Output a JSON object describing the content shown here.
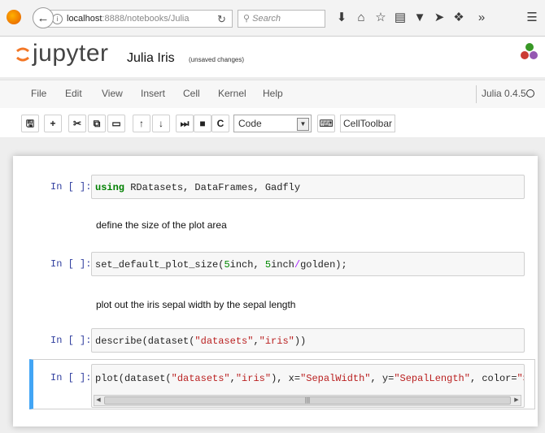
{
  "browser": {
    "url_host": "localhost",
    "url_rest": ":8888/notebooks/Julia",
    "search_placeholder": "Search"
  },
  "jupyter": {
    "logo_text": "jupyter",
    "notebook_name": "Julia Iris",
    "checkpoint_status": "(unsaved changes)"
  },
  "menu": {
    "items": [
      "File",
      "Edit",
      "View",
      "Insert",
      "Cell",
      "Kernel",
      "Help"
    ],
    "kernel_name": "Julia 0.4.5"
  },
  "toolbar": {
    "cell_type": "Code",
    "celltoolbar_label": "CellToolbar"
  },
  "cells": [
    {
      "type": "code",
      "prompt": "In [ ]:",
      "code_kw": "using",
      "code_rest": " RDatasets, DataFrames, Gadfly"
    },
    {
      "type": "markdown",
      "text": "define the size of the plot area"
    },
    {
      "type": "code",
      "prompt": "In [ ]:",
      "code_a": "set_default_plot_size(",
      "num1": "5",
      "code_b": "inch, ",
      "num2": "5",
      "code_c": "inch",
      "op": "/",
      "code_d": "golden);"
    },
    {
      "type": "markdown",
      "text": "plot out the iris sepal width by the sepal length"
    },
    {
      "type": "code",
      "prompt": "In [ ]:",
      "code_a": "describe(dataset(",
      "s1": "\"datasets\"",
      "code_b": ",",
      "s2": "\"iris\"",
      "code_c": "))"
    },
    {
      "type": "code",
      "prompt": "In [ ]:",
      "code_a": "plot(dataset(",
      "s1": "\"datasets\"",
      "code_b": ",",
      "s2": "\"iris\"",
      "code_c": "), x=",
      "s3": "\"SepalWidth\"",
      "code_d": ", y=",
      "s4": "\"SepalLength\"",
      "code_e": ", color=",
      "s5": "\"Species"
    }
  ],
  "colors": {
    "logo_orange": "#f37726",
    "prompt_blue": "#303f9f",
    "keyword_green": "#008000",
    "string_red": "#ba2121",
    "selected_border": "#42a5f5"
  }
}
